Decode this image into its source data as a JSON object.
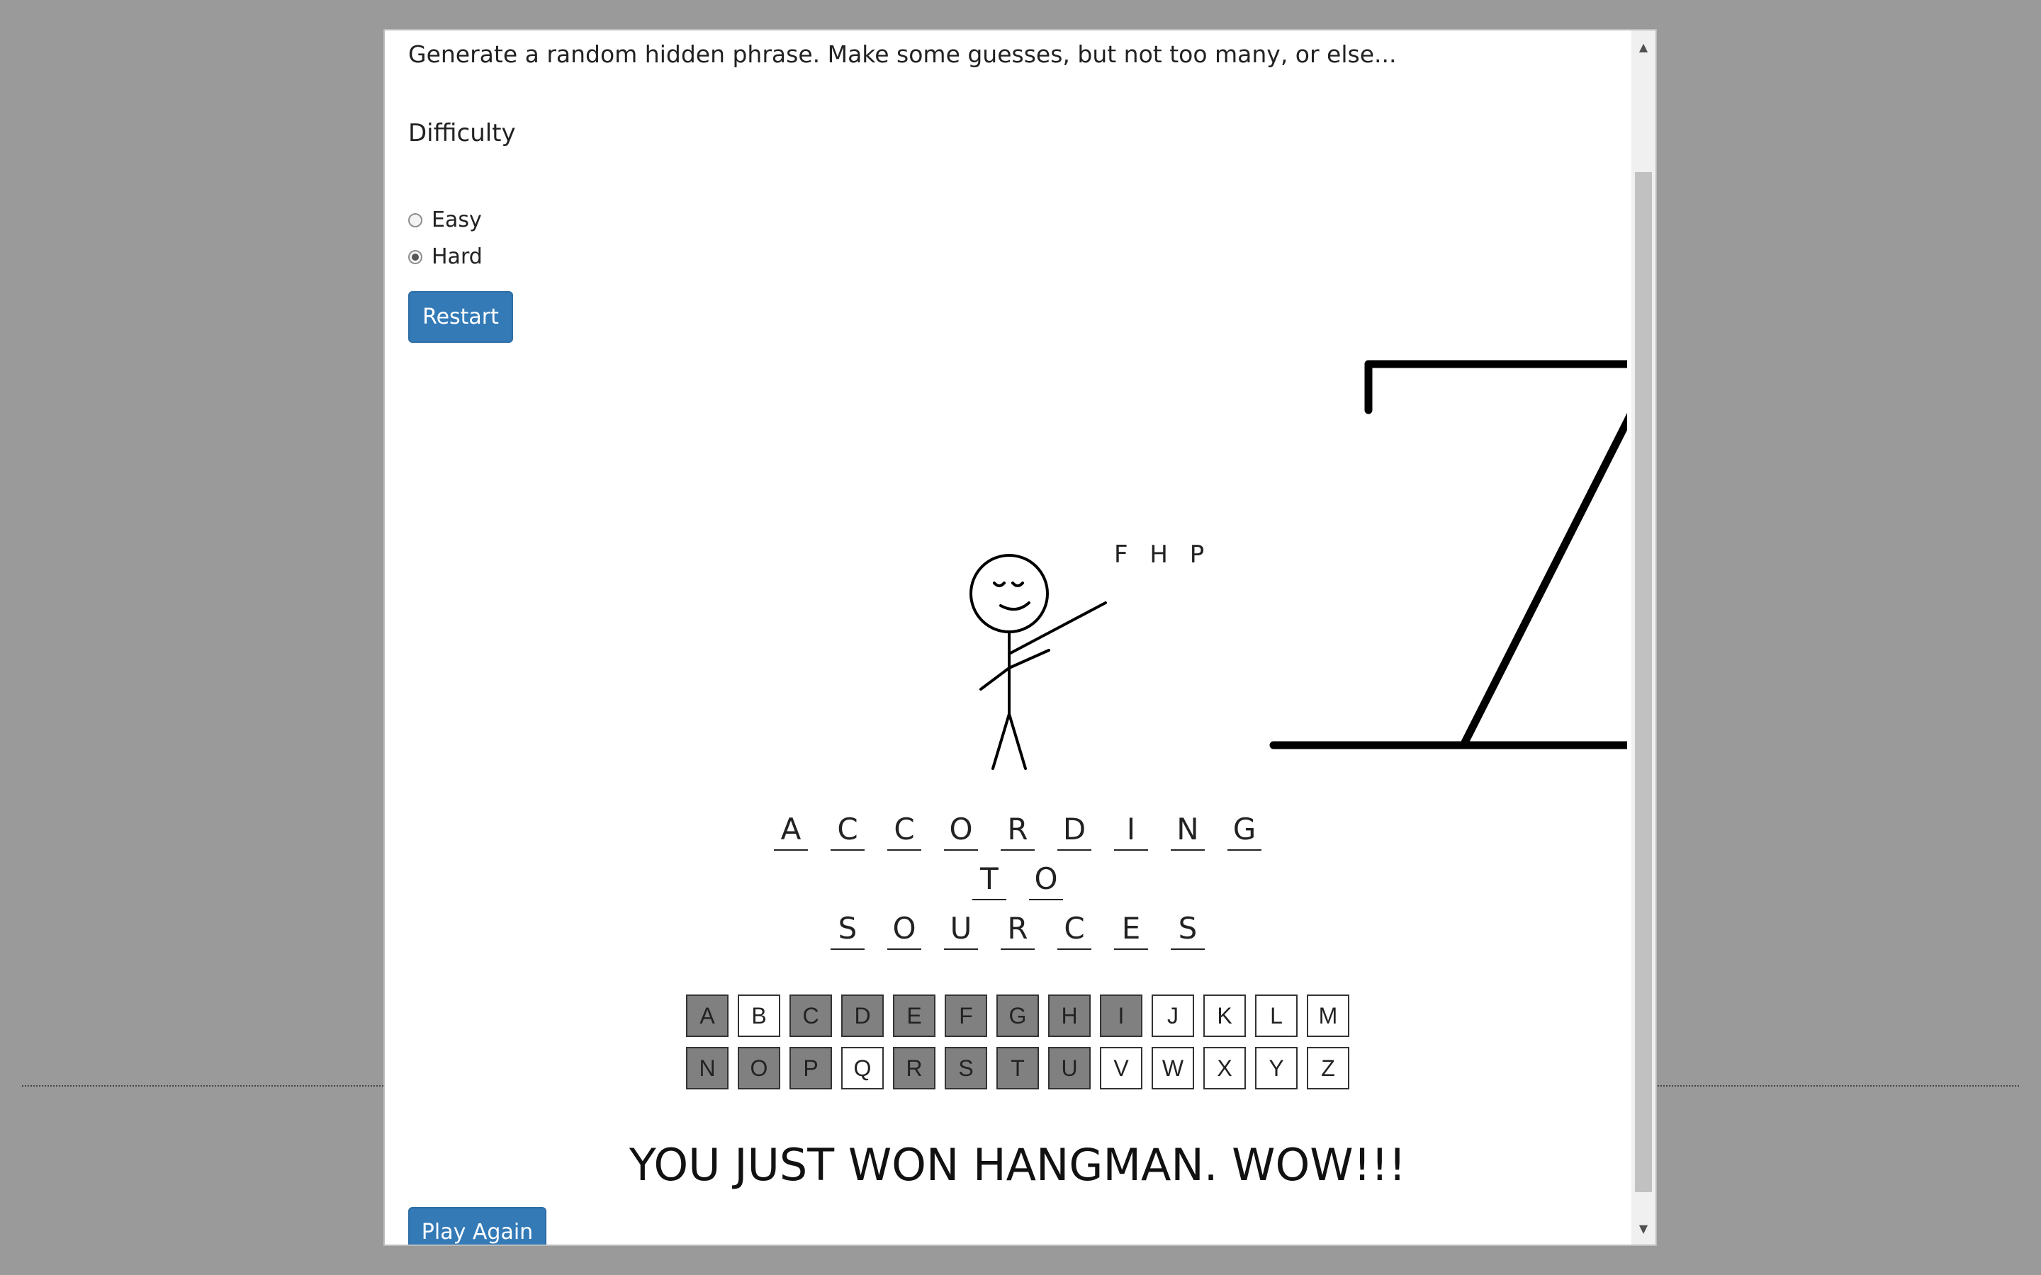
{
  "intro": "Generate a random hidden phrase. Make some guesses, but not too many, or else...",
  "difficulty": {
    "label": "Difficulty",
    "options": [
      {
        "label": "Easy",
        "selected": false
      },
      {
        "label": "Hard",
        "selected": true
      }
    ]
  },
  "restart_label": "Restart",
  "wrong_guesses": "F H P",
  "phrase": [
    [
      "A",
      "C",
      "C",
      "O",
      "R",
      "D",
      "I",
      "N",
      "G"
    ],
    [
      "T",
      "O"
    ],
    [
      "S",
      "O",
      "U",
      "R",
      "C",
      "E",
      "S"
    ]
  ],
  "keyboard": [
    [
      {
        "letter": "A",
        "used": true
      },
      {
        "letter": "B",
        "used": false
      },
      {
        "letter": "C",
        "used": true
      },
      {
        "letter": "D",
        "used": true
      },
      {
        "letter": "E",
        "used": true
      },
      {
        "letter": "F",
        "used": true
      },
      {
        "letter": "G",
        "used": true
      },
      {
        "letter": "H",
        "used": true
      },
      {
        "letter": "I",
        "used": true
      },
      {
        "letter": "J",
        "used": false
      },
      {
        "letter": "K",
        "used": false
      },
      {
        "letter": "L",
        "used": false
      },
      {
        "letter": "M",
        "used": false
      }
    ],
    [
      {
        "letter": "N",
        "used": true
      },
      {
        "letter": "O",
        "used": true
      },
      {
        "letter": "P",
        "used": true
      },
      {
        "letter": "Q",
        "used": false
      },
      {
        "letter": "R",
        "used": true
      },
      {
        "letter": "S",
        "used": true
      },
      {
        "letter": "T",
        "used": true
      },
      {
        "letter": "U",
        "used": true
      },
      {
        "letter": "V",
        "used": false
      },
      {
        "letter": "W",
        "used": false
      },
      {
        "letter": "X",
        "used": false
      },
      {
        "letter": "Y",
        "used": false
      },
      {
        "letter": "Z",
        "used": false
      }
    ]
  ],
  "win_message": "YOU JUST WON HANGMAN. WOW!!!",
  "play_again_label": "Play Again",
  "colors": {
    "backdrop": "#9a9a9a",
    "button": "#337ab7",
    "used_key": "#808080"
  }
}
